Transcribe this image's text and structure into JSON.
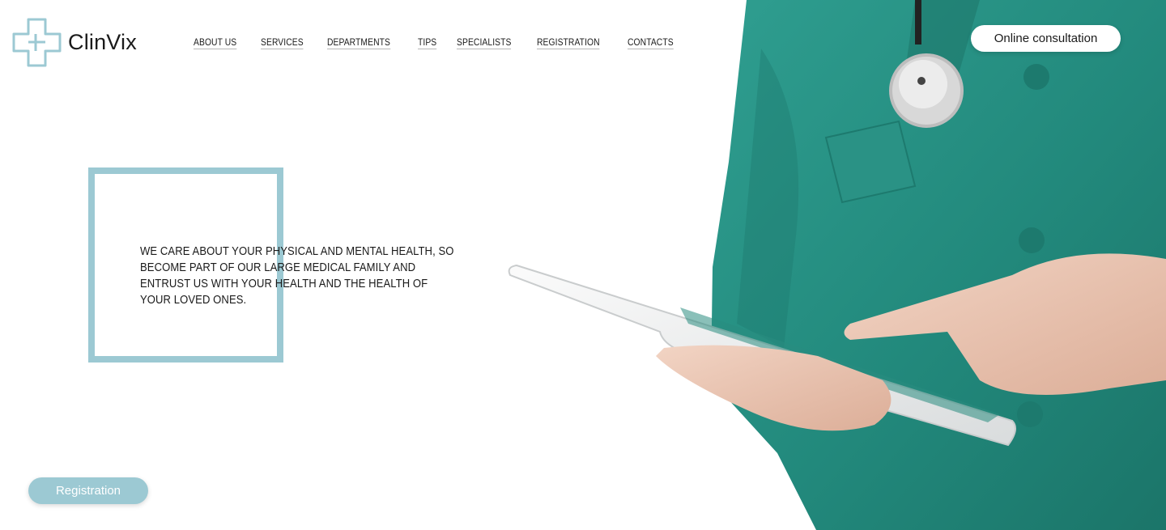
{
  "brand": {
    "name": "ClinVix",
    "accent_color": "#9cc9d3",
    "logo_icon": "medical-cross-icon"
  },
  "nav": {
    "items": [
      {
        "label": "ABOUT US"
      },
      {
        "label": "SERVICES"
      },
      {
        "label": "DEPARTMENTS"
      },
      {
        "label": "TIPS"
      },
      {
        "label": "SPECIALISTS"
      },
      {
        "label": "REGISTRATION"
      },
      {
        "label": "CONTACTS"
      }
    ]
  },
  "header": {
    "consultation_label": "Online consultation"
  },
  "hero": {
    "tagline": "WE CARE ABOUT YOUR PHYSICAL AND MENTAL HEALTH, SO BECOME PART OF OUR LARGE MEDICAL FAMILY AND ENTRUST US WITH YOUR HEALTH AND THE HEALTH OF YOUR LOVED ONES.",
    "registration_label": "Registration",
    "image_subject": "doctor-with-tablet",
    "scrub_color": "#2a9d8f"
  }
}
